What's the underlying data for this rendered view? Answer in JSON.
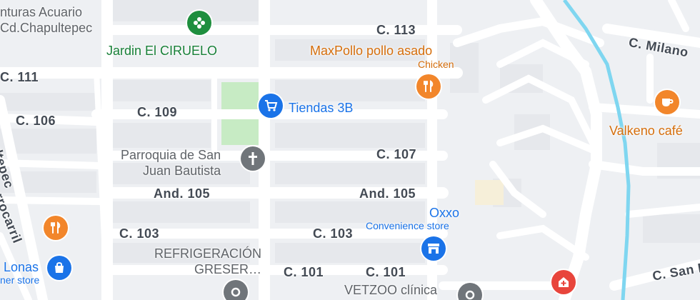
{
  "map": {
    "streets": {
      "c113": "C. 113",
      "c111": "C. 111",
      "c109": "C. 109",
      "c106": "C. 106",
      "c107": "C. 107",
      "and105_left": "And. 105",
      "and105_right": "And. 105",
      "c103_left": "C. 103",
      "c103_right": "C. 103",
      "c101_left": "C. 101",
      "c101_right": "C. 101",
      "milano": "C. Milano",
      "san_r": "C. San R",
      "chapultepec_partial": "pultepec",
      "ferrocarril_partial": "rrocarril"
    },
    "pois": {
      "acuario_line1": "nturas Acuario",
      "acuario_line2": "Cd.Chapultepec",
      "jardin": "Jardin El CIRUELO",
      "maxpollo": "MaxPollo pollo asado",
      "maxpollo_sub": "Chicken",
      "tiendas": "Tiendas 3B",
      "parroquia_line1": "Parroquia de San",
      "parroquia_line2": "Juan Bautista",
      "oxxo": "Oxxo",
      "oxxo_sub": "Convenience store",
      "refrigeracion_line1": "REFRIGERACIÓN",
      "refrigeracion_line2": "GRESER…",
      "vetzoo": "VETZOO clínica",
      "valkeno": "Valkeno café",
      "lonas": "Lonas",
      "lonas_sub": "ner store"
    },
    "icons": {
      "park": "park-icon",
      "restaurant": "restaurant-icon",
      "shopping_cart": "shopping-cart-icon",
      "church": "church-icon",
      "store": "store-icon",
      "cafe": "cafe-icon",
      "shopping_bag": "shopping-bag-icon",
      "hospital": "hospital-icon",
      "place": "place-icon"
    },
    "colors": {
      "background": "#eef0f3",
      "road": "#ffffff",
      "park_fill": "#c7ebc4",
      "water": "#7fd6f0",
      "green_poi": "#1e8e3e",
      "orange_poi": "#f2862b",
      "blue_poi": "#1a73e8",
      "gray_poi": "#70757a",
      "red_poi": "#e8453c"
    }
  }
}
